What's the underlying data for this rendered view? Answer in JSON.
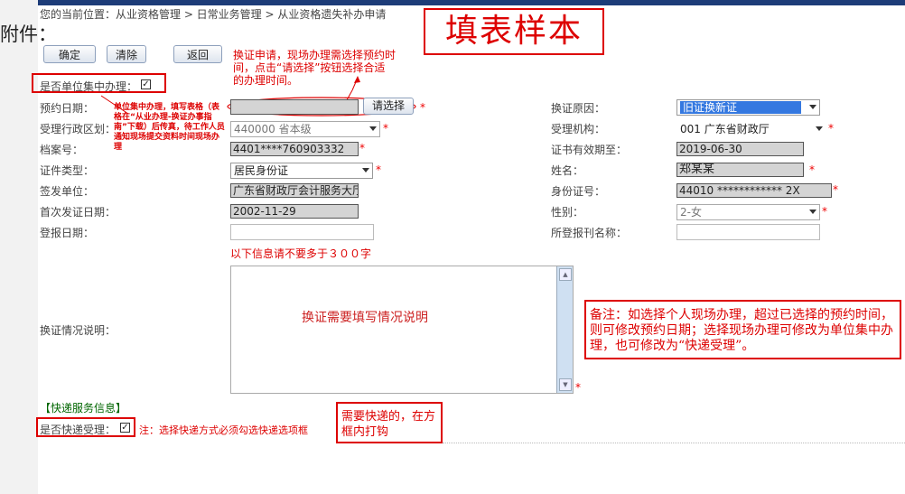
{
  "breadcrumb": "您的当前位置：从业资格管理 > 日常业务管理 > 从业资格遗失补办申请",
  "attachment_label": "附件：",
  "sample_title": "填表样本",
  "toolbar": {
    "confirm": "确定",
    "clear": "清除",
    "back": "返回"
  },
  "notes": {
    "renew_tip": "换证申请，现场办理需选择预约时间，点击“请选择”按钮选择合适的办理时间。",
    "unit_tip": "单位集中办理，填写表格（表格在“从业办理-换证办事指南”下载）后传真，待工作人员通知现场提交资料时间现场办理",
    "char_limit": "以下信息请不要多于３００字",
    "textarea_hint": "换证需要填写情况说明",
    "remark": "备注：如选择个人现场办理，超过已选择的预约时间，则可修改预约日期；选择现场办理可修改为单位集中办理，也可修改为“快递受理”。",
    "express_tip": "需要快递的，在方框内打钩",
    "express_note": "注：选择快递方式必须勾选快递选项框"
  },
  "form": {
    "unit_handle_label": "是否单位集中办理：",
    "unit_handle_checked": true,
    "appt_date_label": "预约日期：",
    "appt_date_value": "",
    "choose_button": "请选择",
    "region_label": "受理行政区划：",
    "region_value": "440000 省本级",
    "file_no_label": "档案号：",
    "file_no_value": "4401****760903332",
    "id_type_label": "证件类型：",
    "id_type_value": "居民身份证",
    "issuer_label": "签发单位：",
    "issuer_value": "广东省财政厅会计服务大厅",
    "first_issue_label": "首次发证日期：",
    "first_issue_value": "2002-11-29",
    "register_date_label": "登报日期：",
    "register_date_value": "",
    "reason_label": "换证原因：",
    "reason_value": "旧证换新证",
    "agency_label": "受理机构：",
    "agency_value": "001 广东省财政厅",
    "valid_until_label": "证书有效期至：",
    "valid_until_value": "2019-06-30",
    "name_label": "姓名：",
    "name_value": "郑某某",
    "id_no_label": "身份证号：",
    "id_no_value": "44010 ************ 2X",
    "gender_label": "性别：",
    "gender_value": "2-女",
    "newspaper_label": "所登报刊名称：",
    "newspaper_value": "",
    "explain_label": "换证情况说明："
  },
  "express": {
    "section_title": "【快递服务信息】",
    "label": "是否快递受理：",
    "checked": true
  },
  "required_mark": "*",
  "colors": {
    "annotation_red": "#dd0000",
    "highlight_blue": "#3478e0",
    "section_green": "#006600"
  }
}
